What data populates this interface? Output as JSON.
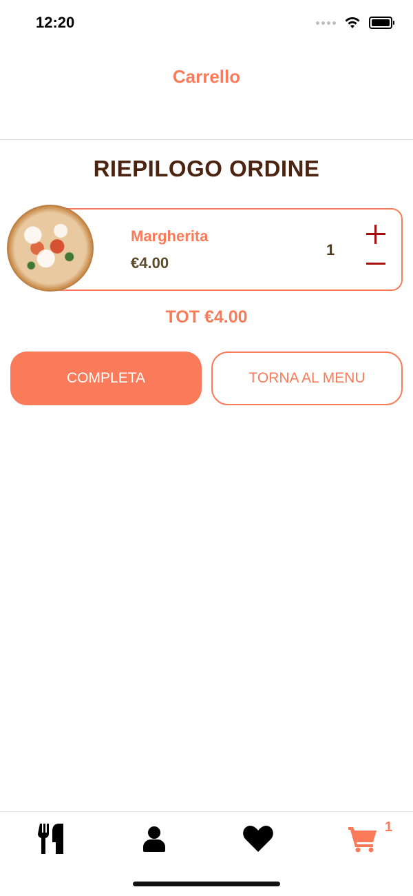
{
  "status_bar": {
    "time": "12:20"
  },
  "nav": {
    "title": "Carrello"
  },
  "summary": {
    "title": "RIEPILOGO ORDINE"
  },
  "cart": {
    "items": [
      {
        "name": "Margherita",
        "price": "€4.00",
        "quantity": "1",
        "image": "pizza-margherita"
      }
    ],
    "total": "TOT €4.00"
  },
  "actions": {
    "complete_label": "COMPLETA",
    "back_label": "TORNA AL MENU"
  },
  "tab_bar": {
    "tabs": [
      {
        "name": "menu",
        "icon": "utensils-icon"
      },
      {
        "name": "profile",
        "icon": "user-icon"
      },
      {
        "name": "favorites",
        "icon": "heart-icon"
      },
      {
        "name": "cart",
        "icon": "cart-icon",
        "active": true
      }
    ],
    "cart_badge": "1"
  },
  "colors": {
    "accent": "#f97b5a",
    "title": "#4a2410",
    "qty_controls": "#a30f0f",
    "tab_inactive": "#000000"
  }
}
